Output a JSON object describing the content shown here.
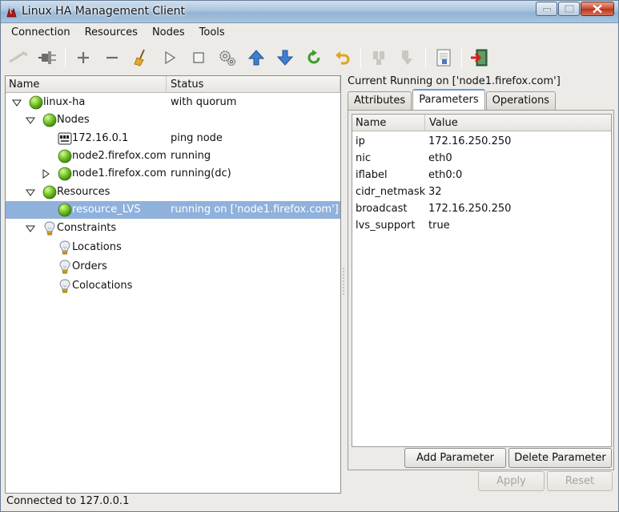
{
  "window": {
    "title": "Linux HA Management Client"
  },
  "menu": [
    {
      "label": "Connection"
    },
    {
      "label": "Resources"
    },
    {
      "label": "Nodes"
    },
    {
      "label": "Tools"
    }
  ],
  "toolbar": [
    {
      "icon": "connect-icon",
      "enabled": false
    },
    {
      "icon": "disconnect-plug-icon",
      "enabled": true
    },
    {
      "separator": true
    },
    {
      "icon": "add-icon",
      "enabled": true
    },
    {
      "icon": "remove-icon",
      "enabled": true
    },
    {
      "icon": "broom-cleanup-icon",
      "enabled": true
    },
    {
      "icon": "play-start-icon",
      "enabled": true
    },
    {
      "icon": "stop-icon",
      "enabled": true
    },
    {
      "icon": "gears-icon",
      "enabled": true
    },
    {
      "icon": "arrow-up-icon",
      "enabled": true
    },
    {
      "icon": "arrow-down-icon",
      "enabled": true
    },
    {
      "icon": "refresh-icon",
      "enabled": true
    },
    {
      "icon": "undo-icon",
      "enabled": true
    },
    {
      "separator": true
    },
    {
      "icon": "standby-node-icon",
      "enabled": false
    },
    {
      "icon": "active-node-icon",
      "enabled": false
    },
    {
      "separator": true
    },
    {
      "icon": "document-icon",
      "enabled": true
    },
    {
      "separator": true
    },
    {
      "icon": "exit-icon",
      "enabled": true
    }
  ],
  "tree": {
    "columns": [
      "Name",
      "Status"
    ],
    "rows": [
      {
        "name": "linux-ha",
        "status": "with quorum",
        "level": 0,
        "expander": "open",
        "icon": "green"
      },
      {
        "name": "Nodes",
        "status": "",
        "level": 1,
        "expander": "open",
        "icon": "green"
      },
      {
        "name": "172.16.0.1",
        "status": "ping node",
        "level": 2,
        "expander": "none",
        "icon": "ping"
      },
      {
        "name": "node2.firefox.com",
        "status": "running",
        "level": 2,
        "expander": "none",
        "icon": "green"
      },
      {
        "name": "node1.firefox.com",
        "status": "running(dc)",
        "level": 2,
        "expander": "closed",
        "icon": "green"
      },
      {
        "name": "Resources",
        "status": "",
        "level": 1,
        "expander": "open",
        "icon": "green"
      },
      {
        "name": "resource_LVS",
        "status": "running on ['node1.firefox.com']",
        "level": 2,
        "expander": "none",
        "icon": "green",
        "selected": true
      },
      {
        "name": "Constraints",
        "status": "",
        "level": 1,
        "expander": "open",
        "icon": "bulb"
      },
      {
        "name": "Locations",
        "status": "",
        "level": 2,
        "expander": "none",
        "icon": "bulb"
      },
      {
        "name": "Orders",
        "status": "",
        "level": 2,
        "expander": "none",
        "icon": "bulb"
      },
      {
        "name": "Colocations",
        "status": "",
        "level": 2,
        "expander": "none",
        "icon": "bulb"
      }
    ]
  },
  "detail": {
    "title": "Current Running on ['node1.firefox.com']",
    "tabs": [
      {
        "label": "Attributes",
        "active": false
      },
      {
        "label": "Parameters",
        "active": true
      },
      {
        "label": "Operations",
        "active": false
      }
    ],
    "columns": [
      "Name",
      "Value"
    ],
    "params": [
      {
        "name": "ip",
        "value": "172.16.250.250"
      },
      {
        "name": "nic",
        "value": "eth0"
      },
      {
        "name": "iflabel",
        "value": "eth0:0"
      },
      {
        "name": "cidr_netmask",
        "value": "32"
      },
      {
        "name": "broadcast",
        "value": "172.16.250.250"
      },
      {
        "name": "lvs_support",
        "value": "true"
      }
    ],
    "buttons": {
      "add": "Add Parameter",
      "delete": "Delete Parameter",
      "apply": "Apply",
      "reset": "Reset"
    }
  },
  "status_text": "Connected to 127.0.0.1"
}
